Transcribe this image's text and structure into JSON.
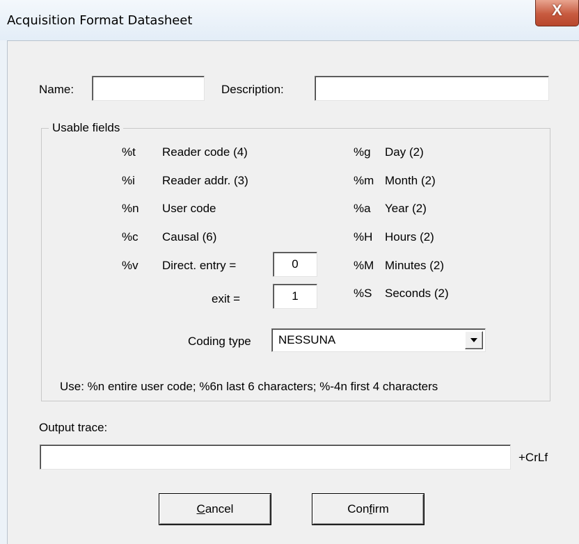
{
  "window": {
    "title": "Acquisition Format Datasheet",
    "close_glyph": "X"
  },
  "form": {
    "name_label": "Name:",
    "name_value": "",
    "description_label": "Description:",
    "description_value": ""
  },
  "usable_fields": {
    "title": "Usable fields",
    "left": [
      {
        "code": "%t",
        "label": "Reader code (4)"
      },
      {
        "code": "%i",
        "label": "Reader addr. (3)"
      },
      {
        "code": "%n",
        "label": "User code"
      },
      {
        "code": "%c",
        "label": "Causal (6)"
      },
      {
        "code": "%v",
        "label": "Direct. entry ="
      }
    ],
    "right": [
      {
        "code": "%g",
        "label": "Day (2)"
      },
      {
        "code": "%m",
        "label": "Month (2)"
      },
      {
        "code": "%a",
        "label": "Year (2)"
      },
      {
        "code": "%H",
        "label": "Hours (2)"
      },
      {
        "code": "%M",
        "label": "Minutes (2)"
      },
      {
        "code": "%S",
        "label": "Seconds (2)"
      }
    ],
    "entry_value": "0",
    "exit_label": "exit =",
    "exit_value": "1",
    "coding_type_label": "Coding type",
    "coding_type_value": "NESSUNA",
    "usage_note": "Use: %n entire user code; %6n last 6 characters; %-4n first 4 characters"
  },
  "output": {
    "label": "Output trace:",
    "value": "",
    "suffix": "+CrLf"
  },
  "buttons": {
    "cancel_mnemonic": "C",
    "cancel_rest": "ancel",
    "confirm_pre": "Con",
    "confirm_mnemonic": "f",
    "confirm_post": "irm"
  },
  "icons": {
    "close": "close-icon",
    "dropdown": "chevron-down-icon"
  }
}
